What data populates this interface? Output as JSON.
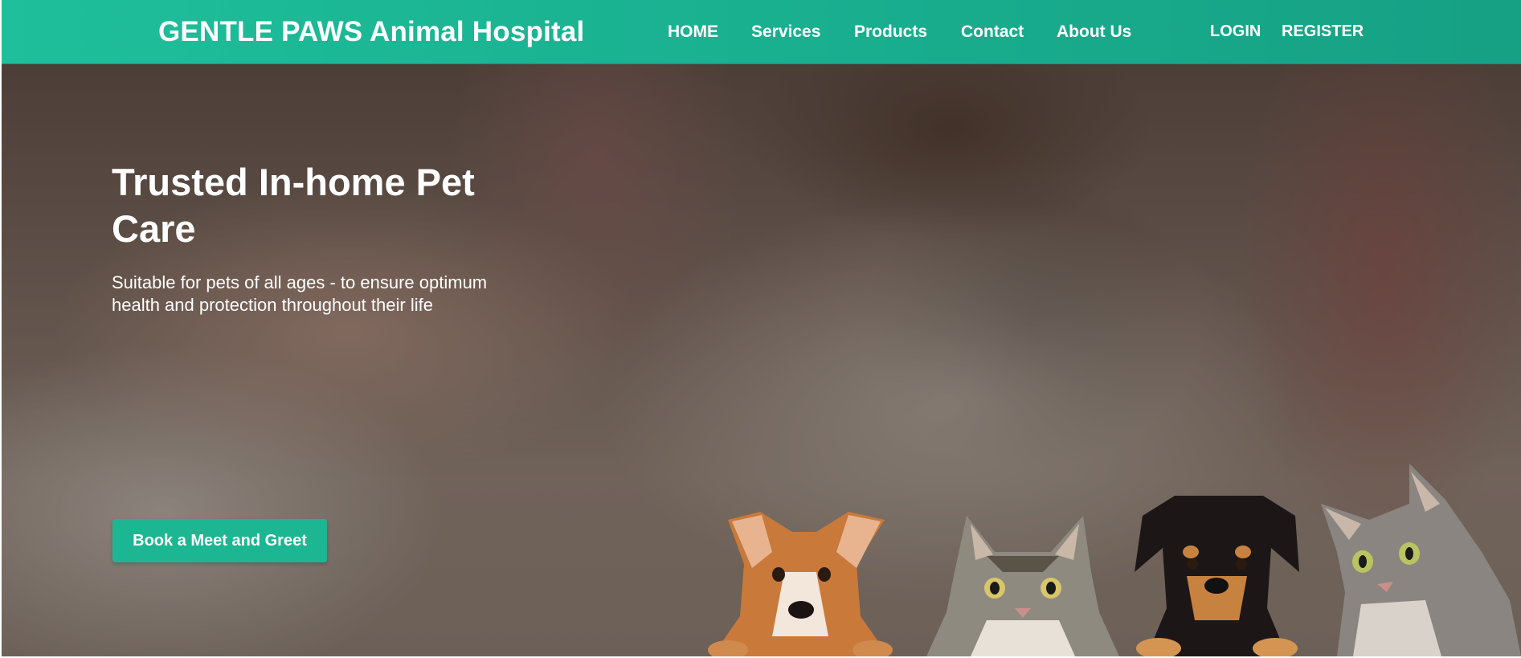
{
  "header": {
    "brand": "GENTLE PAWS Animal Hospital",
    "nav": [
      {
        "label": "HOME"
      },
      {
        "label": "Services"
      },
      {
        "label": "Products"
      },
      {
        "label": "Contact"
      },
      {
        "label": "About Us"
      }
    ],
    "auth": {
      "login": "LOGIN",
      "register": "REGISTER"
    }
  },
  "hero": {
    "title": "Trusted In-home Pet Care",
    "subtitle": "Suitable for pets of all ages - to ensure optimum health and protection throughout their life",
    "cta_label": "Book a Meet and Greet"
  },
  "colors": {
    "header": "#1db692",
    "button": "#1db692",
    "text": "#ffffff"
  },
  "images": {
    "background": "blurred photo of person holding a cat",
    "pets": [
      "brown-dog",
      "tabby-cat",
      "black-tan-puppy",
      "grey-tabby-cat"
    ]
  }
}
